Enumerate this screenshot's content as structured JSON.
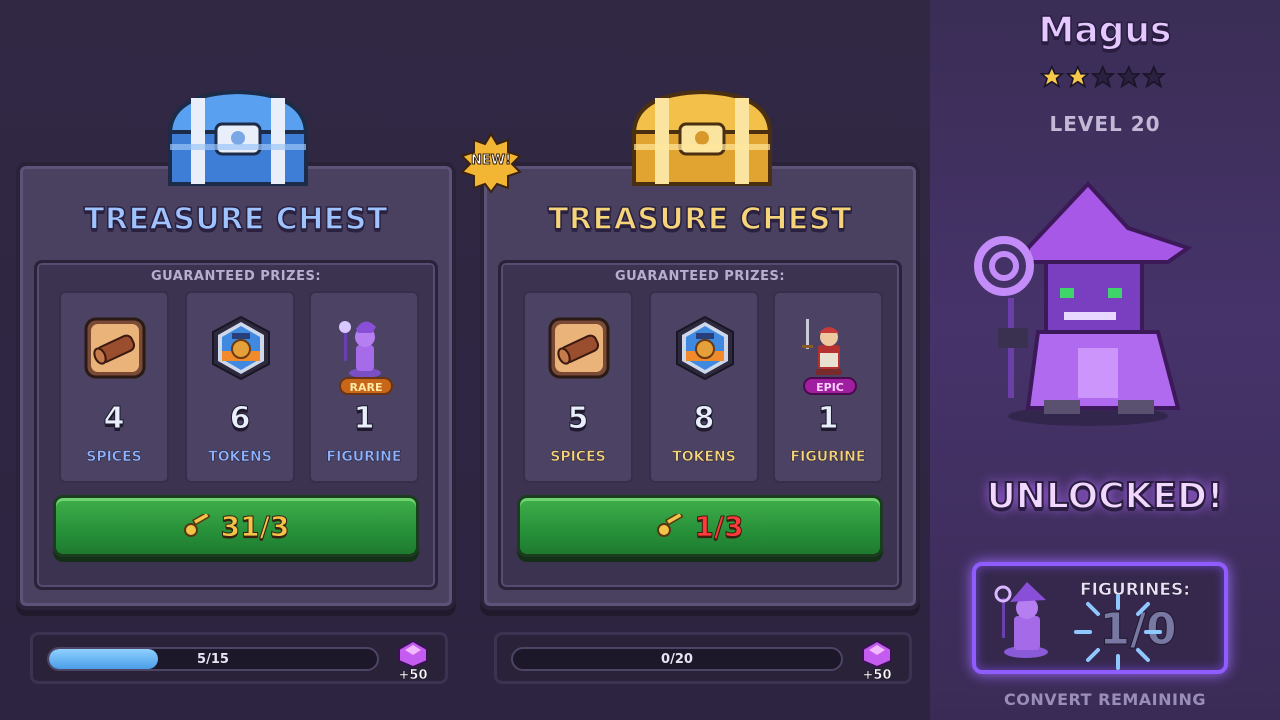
{
  "chests": [
    {
      "title": "TREASURE CHEST",
      "guaranteed_label": "GUARANTEED PRIZES:",
      "prizes": [
        {
          "count": "4",
          "label": "SPICES",
          "icon": "spice-log-icon"
        },
        {
          "count": "6",
          "label": "TOKENS",
          "icon": "token-badge-icon"
        },
        {
          "count": "1",
          "label": "FIGURINE",
          "icon": "figurine-mage-icon",
          "rarity": "RARE"
        }
      ],
      "button_text": "31/3",
      "progress": {
        "text": "5/15",
        "value": 5,
        "max": 15
      },
      "gem_reward": "+50",
      "color": "#9ec3ff"
    },
    {
      "title": "TREASURE CHEST",
      "guaranteed_label": "GUARANTEED PRIZES:",
      "badge": "NEW!",
      "prizes": [
        {
          "count": "5",
          "label": "SPICES",
          "icon": "spice-log-icon"
        },
        {
          "count": "8",
          "label": "TOKENS",
          "icon": "token-badge-icon"
        },
        {
          "count": "1",
          "label": "FIGURINE",
          "icon": "figurine-warrior-icon",
          "rarity": "EPIC"
        }
      ],
      "button_text": "1/3",
      "progress": {
        "text": "0/20",
        "value": 0,
        "max": 20
      },
      "gem_reward": "+50",
      "color": "#f6d47a"
    }
  ],
  "hero": {
    "name": "Magus",
    "stars_filled": 2,
    "stars_total": 5,
    "level": "LEVEL 20",
    "status": "UNLOCKED!",
    "figurines_label": "FIGURINES:",
    "figurines_count": "1/0",
    "convert_text": "CONVERT REMAINING"
  },
  "colors": {
    "button_green": "#27913a",
    "progress_blue": "#4a9de8",
    "accent_purple": "#8f5cff"
  }
}
